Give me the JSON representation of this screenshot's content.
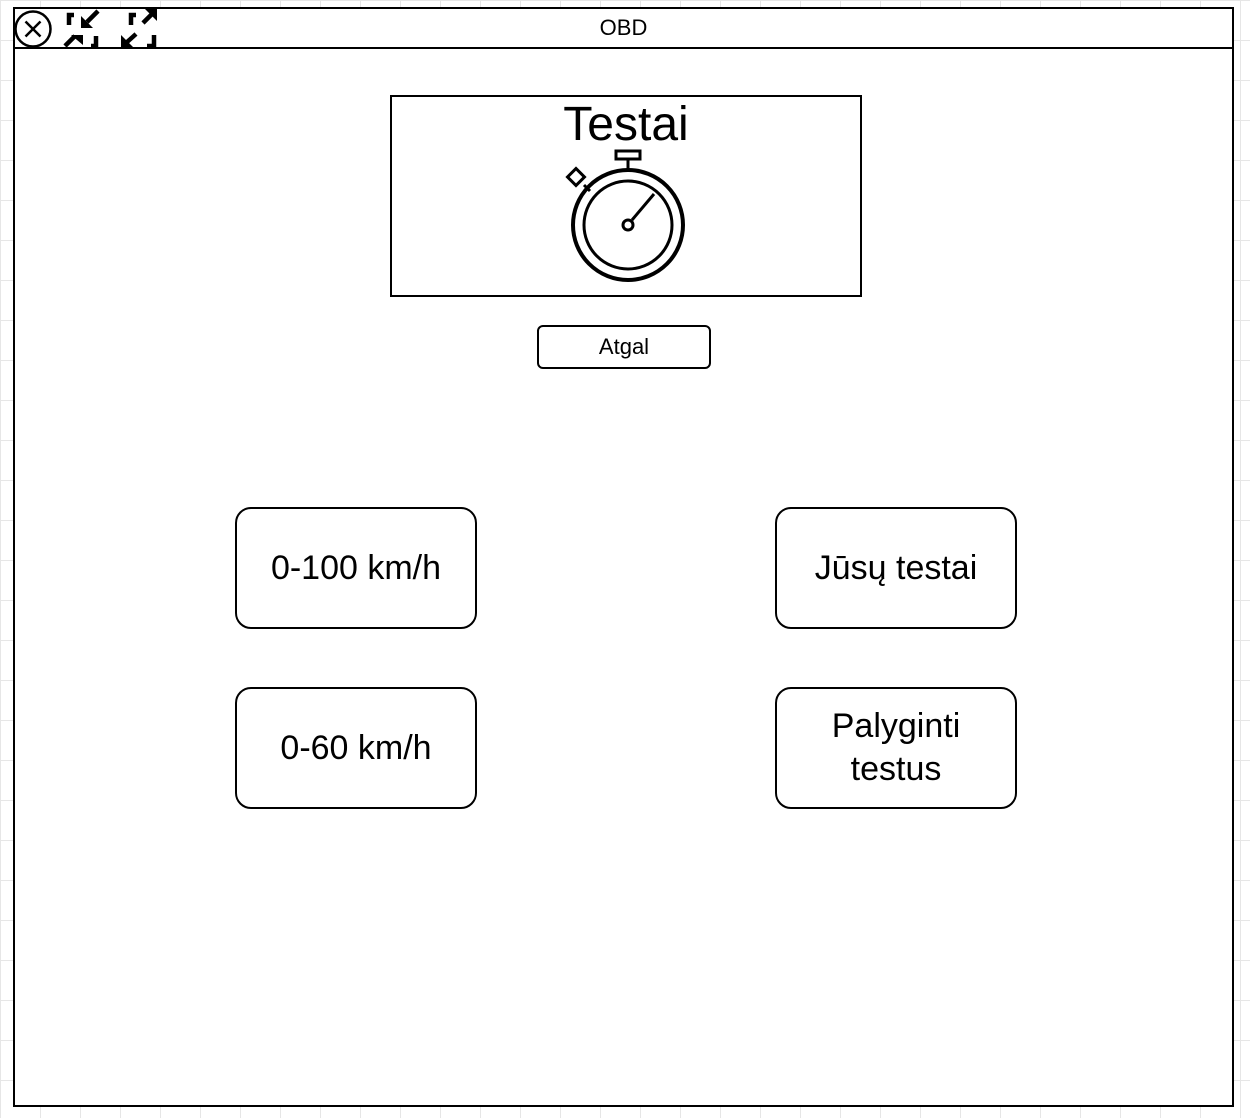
{
  "window": {
    "title": "OBD",
    "controls": {
      "close_icon": "close-circle-icon",
      "minimize_icon": "collapse-arrows-icon",
      "maximize_icon": "expand-arrows-icon"
    }
  },
  "header": {
    "title": "Testai",
    "icon": "stopwatch-icon"
  },
  "back_button": {
    "label": "Atgal"
  },
  "tests": {
    "accel_100_label": "0-100 km/h",
    "accel_60_label": "0-60 km/h",
    "your_tests_label": "Jūsų testai",
    "compare_label": "Palyginti testus"
  },
  "colors": {
    "stroke": "#000000",
    "background": "#ffffff",
    "grid": "#e6e6e6"
  }
}
